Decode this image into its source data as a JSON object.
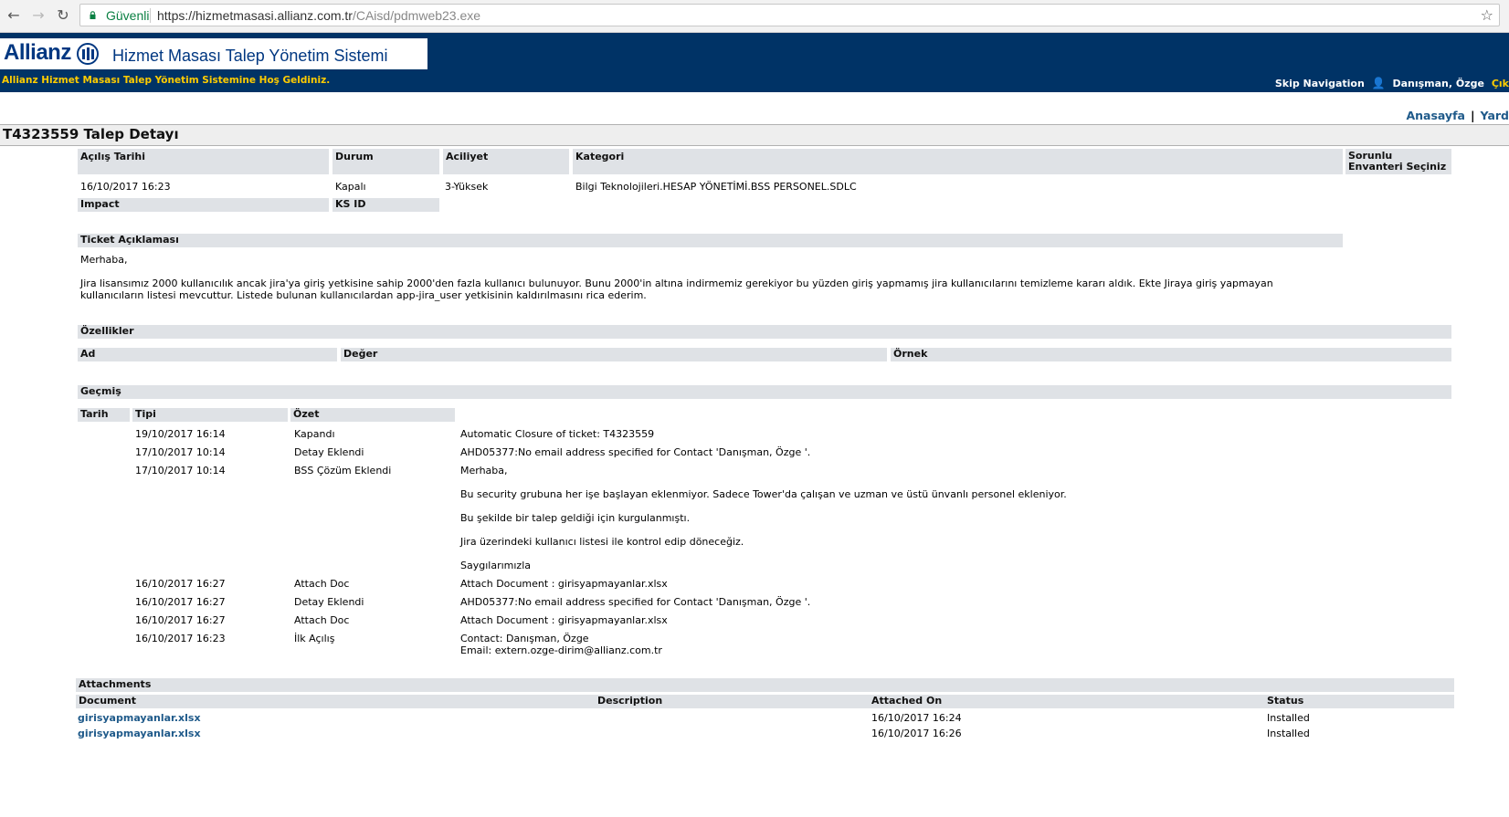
{
  "browser": {
    "secure_label": "Güvenli",
    "url_host": "https://hizmetmasasi.allianz.com.tr",
    "url_path": "/CAisd/pdmweb23.exe"
  },
  "header": {
    "logo_text": "Allianz",
    "app_title": "Hizmet Masası Talep Yönetim Sistemi",
    "welcome": "Allianz Hizmet Masası Talep Yönetim Sistemine Hoş Geldiniz.",
    "skip_nav": "Skip Navigation",
    "user_name": "Danışman, Özge",
    "logout": "Çık"
  },
  "toplinks": {
    "home": "Anasayfa",
    "separator": "|",
    "help": "Yard"
  },
  "page_title": "T4323559 Talep Detayı",
  "detail": {
    "labels": {
      "opened": "Açılış Tarihi",
      "status": "Durum",
      "urgency": "Aciliyet",
      "category": "Kategori",
      "inventory": "Sorunlu Envanteri Seçiniz",
      "impact": "Impact",
      "ksid": "KS ID"
    },
    "opened": "16/10/2017 16:23",
    "status": "Kapalı",
    "urgency": "3-Yüksek",
    "category": "Bilgi Teknolojileri.HESAP YÖNETİMİ.BSS PERSONEL.SDLC"
  },
  "ticket": {
    "label": "Ticket Açıklaması",
    "greeting": "Merhaba,",
    "line1": "Jira lisansımız 2000 kullanıcılık ancak jira'ya giriş yetkisine sahip 2000'den fazla kullanıcı bulunuyor. Bunu 2000'in altına indirmemiz gerekiyor bu yüzden giriş yapmamış jira kullanıcılarını temizleme kararı aldık. Ekte Jiraya giriş yapmayan",
    "line2": "kullanıcıların listesi mevcuttur. Listede bulunan kullanıcılardan app-jira_user yetkisinin kaldırılmasını rica ederim."
  },
  "properties": {
    "label": "Özellikler",
    "col_name": "Ad",
    "col_value": "Değer",
    "col_example": "Örnek"
  },
  "history": {
    "label": "Geçmiş",
    "col_date": "Tarih",
    "col_type": "Tipi",
    "col_summary": "Özet",
    "rows": [
      {
        "date": "19/10/2017 16:14",
        "type": "Kapandı",
        "summary": "Automatic Closure of ticket: T4323559"
      },
      {
        "date": "17/10/2017 10:14",
        "type": "Detay Eklendi",
        "summary": "AHD05377:No email address specified for Contact 'Danışman, Özge '."
      },
      {
        "date": "17/10/2017 10:14",
        "type": "BSS Çözüm Eklendi",
        "summary": "Merhaba,"
      },
      {
        "date": "16/10/2017 16:27",
        "type": "Attach Doc",
        "summary": "Attach Document : girisyapmayanlar.xlsx"
      },
      {
        "date": "16/10/2017 16:27",
        "type": "Detay Eklendi",
        "summary": "AHD05377:No email address specified for Contact 'Danışman, Özge '."
      },
      {
        "date": "16/10/2017 16:27",
        "type": "Attach Doc",
        "summary": "Attach Document : girisyapmayanlar.xlsx"
      },
      {
        "date": "16/10/2017 16:23",
        "type": "İlk Açılış",
        "summary": "Contact: Danışman, Özge"
      }
    ],
    "solution_lines": [
      "Bu security grubuna her işe başlayan eklenmiyor. Sadece Tower'da çalışan ve uzman ve üstü ünvanlı personel ekleniyor.",
      "Bu şekilde bir talep geldiği için kurgulanmıştı.",
      "Jira üzerindeki kullanıcı listesi ile kontrol edip döneceğiz.",
      "Saygılarımızla"
    ],
    "first_open_email": "Email: extern.ozge-dirim@allianz.com.tr"
  },
  "attachments": {
    "label": "Attachments",
    "col_document": "Document",
    "col_description": "Description",
    "col_attached_on": "Attached On",
    "col_status": "Status",
    "rows": [
      {
        "document": "girisyapmayanlar.xlsx",
        "description": "",
        "attached_on": "16/10/2017 16:24",
        "status": "Installed"
      },
      {
        "document": "girisyapmayanlar.xlsx",
        "description": "",
        "attached_on": "16/10/2017 16:26",
        "status": "Installed"
      }
    ]
  }
}
